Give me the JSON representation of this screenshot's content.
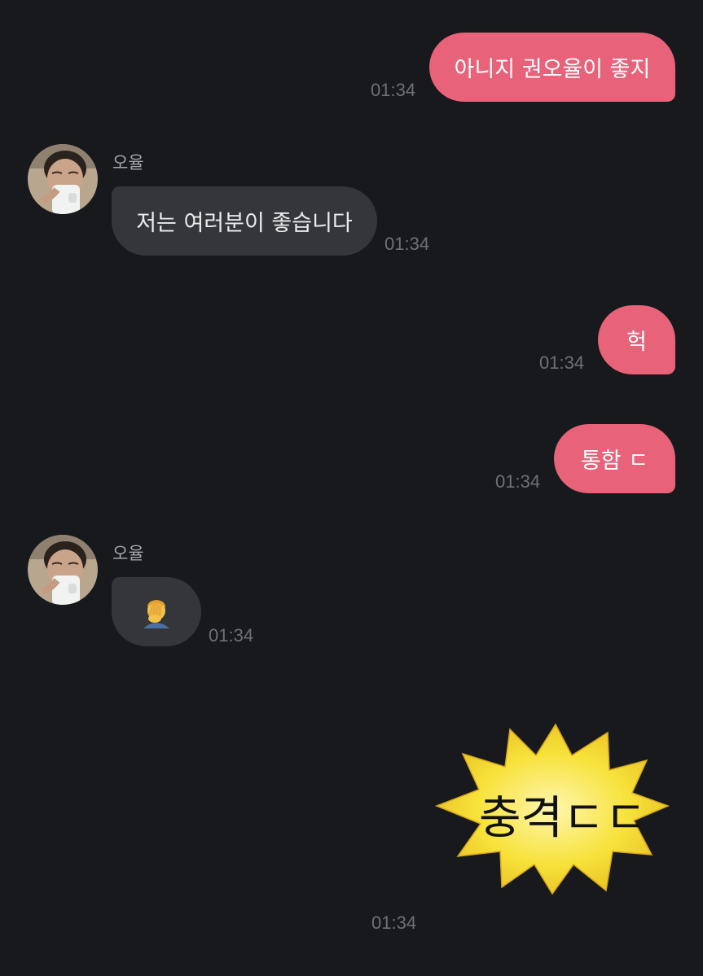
{
  "conversation": {
    "messages": [
      {
        "direction": "outgoing",
        "text": "아니지 권오율이 좋지",
        "time": "01:34"
      },
      {
        "direction": "incoming",
        "sender": "오율",
        "text": "저는 여러분이 좋습니다",
        "time": "01:34"
      },
      {
        "direction": "outgoing",
        "text": "헉",
        "time": "01:34"
      },
      {
        "direction": "outgoing",
        "text": "통함 ㄷ",
        "time": "01:34"
      },
      {
        "direction": "incoming",
        "sender": "오율",
        "emoji": "man-facepalming-emoji",
        "time": "01:34"
      },
      {
        "direction": "outgoing",
        "sticker": {
          "text": "충격ㄷㄷ",
          "shape": "yellow-starburst"
        },
        "time": "01:34"
      }
    ]
  },
  "colors": {
    "background": "#18191c",
    "outgoing_bubble": "#e8627a",
    "incoming_bubble": "#353639",
    "timestamp": "#6f7076",
    "sticker_fill": "#f7e23a"
  }
}
